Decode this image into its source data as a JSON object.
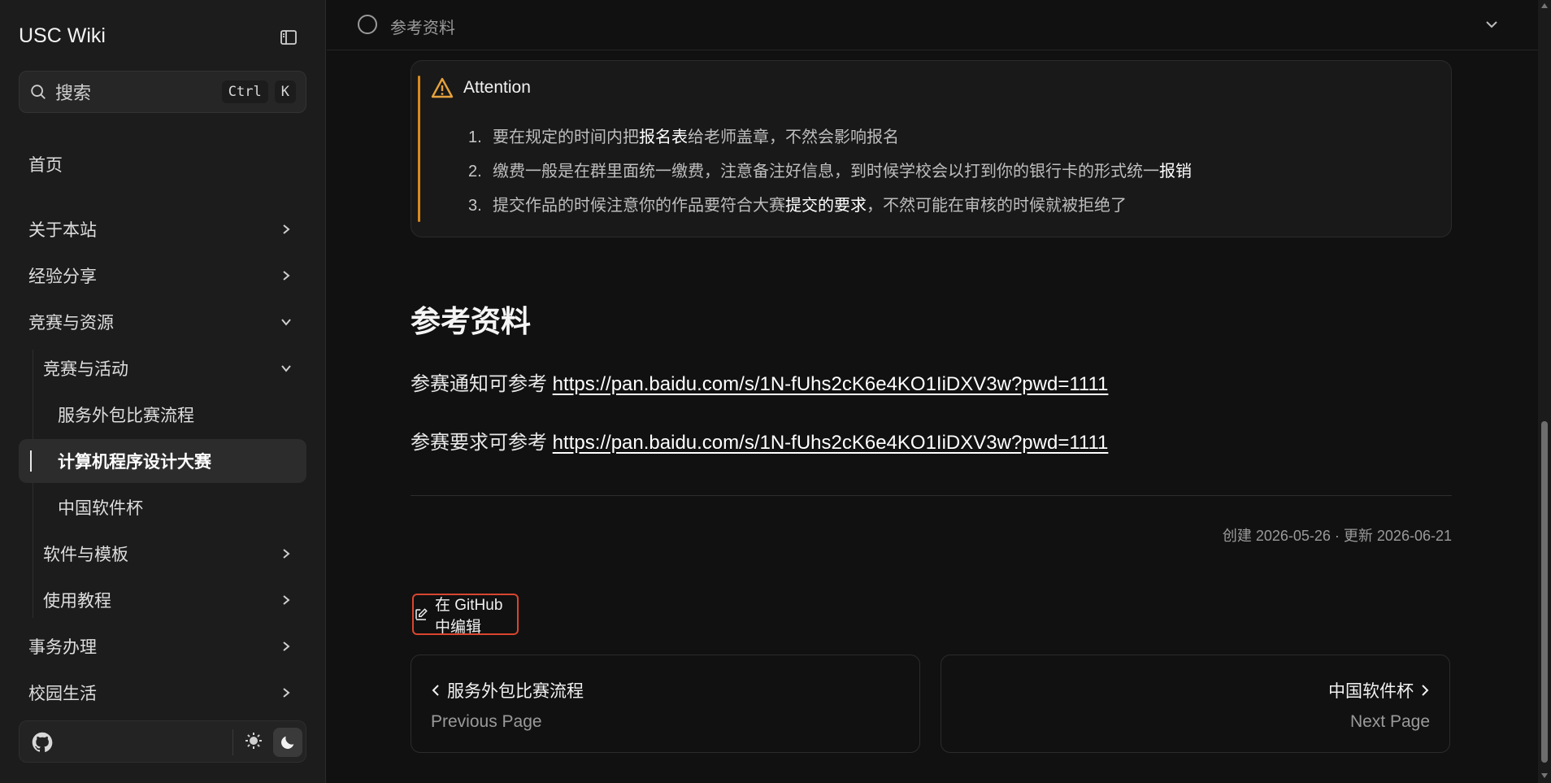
{
  "sidebar": {
    "brand": "USC Wiki",
    "search": {
      "label": "搜索",
      "kbd_ctrl": "Ctrl",
      "kbd_k": "K"
    },
    "items": [
      {
        "label": "首页"
      },
      {
        "label": "关于本站"
      },
      {
        "label": "经验分享"
      },
      {
        "label": "竞赛与资源"
      },
      {
        "label": "竞赛与活动"
      },
      {
        "label": "服务外包比赛流程"
      },
      {
        "label": "计算机程序设计大赛"
      },
      {
        "label": "中国软件杯"
      },
      {
        "label": "软件与模板"
      },
      {
        "label": "使用教程"
      },
      {
        "label": "事务办理"
      },
      {
        "label": "校园生活"
      }
    ]
  },
  "topbar": {
    "toc_label": "参考资料"
  },
  "callout": {
    "title": "Attention",
    "items": [
      {
        "num": "1.",
        "pre": "要在规定的时间内把",
        "bold": "报名表",
        "post": "给老师盖章，不然会影响报名"
      },
      {
        "num": "2.",
        "pre": "缴费一般是在群里面统一缴费，注意备注好信息，到时候学校会以打到你的银行卡的形式统一",
        "bold": "报销",
        "post": ""
      },
      {
        "num": "3.",
        "pre": "提交作品的时候注意你的作品要符合大赛",
        "bold": "提交的要求",
        "post": "，不然可能在审核的时候就被拒绝了"
      }
    ]
  },
  "content": {
    "heading": "参考资料",
    "para1_prefix": "参赛通知可参考 ",
    "para1_link": "https://pan.baidu.com/s/1N-fUhs2cK6e4KO1IiDXV3w?pwd=1111",
    "para2_prefix": "参赛要求可参考 ",
    "para2_link": "https://pan.baidu.com/s/1N-fUhs2cK6e4KO1IiDXV3w?pwd=1111",
    "meta": "创建 2026-05-26 · 更新 2026-06-21"
  },
  "edit": {
    "label": "在 GitHub 中编辑"
  },
  "pager": {
    "prev_title": "服务外包比赛流程",
    "prev_sub": "Previous Page",
    "next_title": "中国软件杯",
    "next_sub": "Next Page"
  },
  "colors": {
    "accent_warning": "#d98a1f",
    "highlight_border": "#d9452f"
  }
}
